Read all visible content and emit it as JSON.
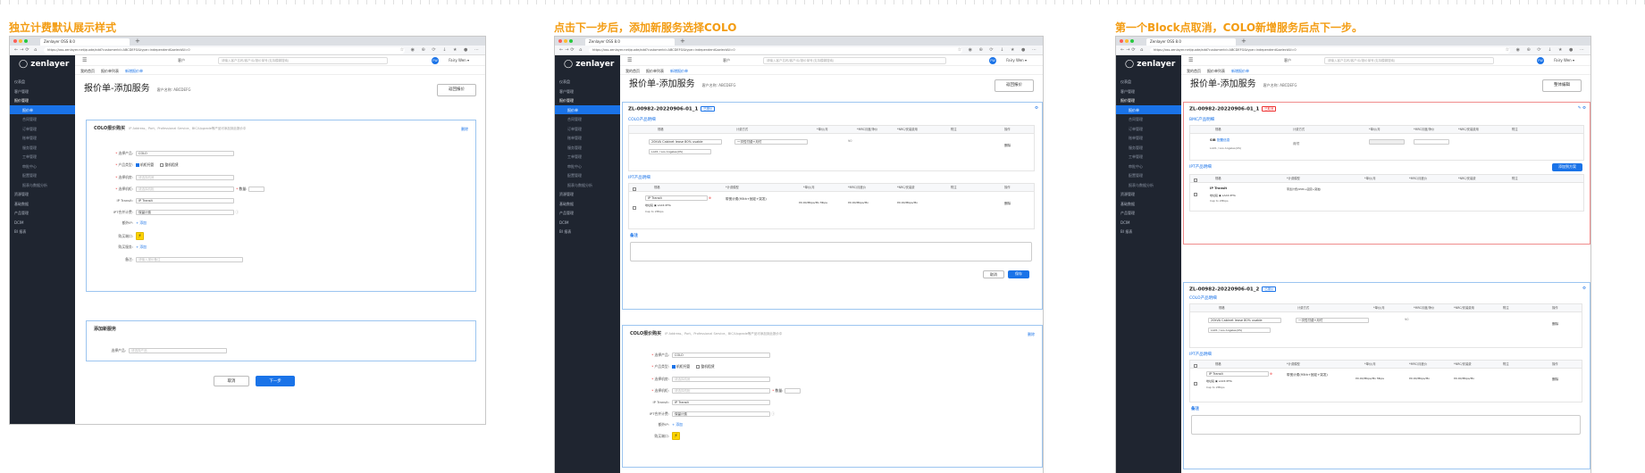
{
  "captions": [
    "独立计费默认展示样式",
    "点击下一步后，添加新服务选择COLO",
    "第一个Block点取消，COLO新增服务后点下一步。"
  ],
  "browser": {
    "tab_title": "Zenlayer OSS 8.0",
    "url": "https://oss.zenlayer.net/quote/add?customerId=ABCDEFG&type=independent&selectAll=0",
    "logo": "zenlayer"
  },
  "topbar": {
    "customer_select": "客户",
    "search_placeholder": "请输入客户名称/客户ID/报价单号(支持模糊搜索)",
    "avatar": "FW",
    "user": "Fairy Wen ▾"
  },
  "sidebar": {
    "items": [
      "仪表盘",
      "客户管理",
      "报价管理",
      "报价单",
      "合同管理",
      "订单管理",
      "账单管理",
      "服务管理",
      "工单管理",
      "审批中心",
      "配置管理",
      "报表与数据分析",
      "资源管理",
      "基础数据",
      "产品管理",
      "DCIM",
      "BI 报表"
    ],
    "active_index": 3
  },
  "breadcrumbs": [
    "我的首页",
    "报价单列表",
    "新增报价单"
  ],
  "page": {
    "title": "报价单-添加服务",
    "customer": "客户名称: ABCDEFG",
    "back_button": "返回报价"
  },
  "colo_form": {
    "heading": "COLO报价购买",
    "heading_hint": "IP Address、Port、Professional Service、BIC/Upgrade等产品可添加到此报价中",
    "delete": "删除",
    "labels": [
      "选择产品:",
      "产品类型:",
      "选择机房:",
      "选择机柜:",
      "IP Transit:",
      "IPT合并计费:",
      "额外IP:",
      "购买端口:",
      "购买服务:",
      "备注:"
    ],
    "product": "COLO",
    "type_options": [
      "机柜托管",
      "整机租赁"
    ],
    "room_placeholder": "请选择机房",
    "cabinet_placeholder": "请选择机柜",
    "quantity_label": "数量:",
    "ip_transit": "IP Transit",
    "ipt_billing": "保留计费",
    "add": "+ 添加",
    "remark_placeholder": "请输入报价备注"
  },
  "add_service": {
    "heading": "添加新服务",
    "label": "选择产品:",
    "placeholder": "请选择产品"
  },
  "buttons": {
    "cancel": "取消",
    "next": "下一步",
    "save": "保存",
    "edit_all": "整体编辑"
  },
  "block": {
    "code1": "ZL-00982-20220906-01_1",
    "code2": "ZL-00982-20220906-01_2",
    "tag_new": "已报价",
    "tag_cancel": "已取消",
    "colo_section": "COLO产品明细",
    "ipt_section": "IPT产品明细",
    "bmc_section": "BMC产品明细",
    "colo_headers": [
      "规格",
      "计费方式",
      "*单价/月",
      "*MRC月度/净价",
      "*NRC/安装费用",
      "附注",
      "操作"
    ],
    "ipt_headers": [
      "规格",
      "*计费模型",
      "*单价/月",
      "*MRC/月度价",
      "*NRC/安装费",
      "附注",
      "操作"
    ],
    "cabinet": "20kVA Cabinet lease 80% usable",
    "cabinet_sub": "LAX1 / Los Angeles(US)",
    "billing": "一次性付费+月付",
    "mrc": "¥0",
    "operate": "删除",
    "ipt_product": "IP Transit",
    "ipt_model": "带宽计费(95th+固定+突发)",
    "ipt_sub1": "地址段 ▣ LAX4 IPTA",
    "ipt_sub2": "Cap to 2Mbps",
    "ipt_price": "¥0.00/Mbps/Mo",
    "ipt_unit": "Mbps",
    "remark": "备注",
    "bmc_product": "SIB",
    "bmc_tag": "配置信息",
    "bmc_location": "LAX1 / Los Angeles(US)",
    "bmc_billing": "月付"
  },
  "shot3": {
    "add_to_plan": "添加到方案"
  }
}
